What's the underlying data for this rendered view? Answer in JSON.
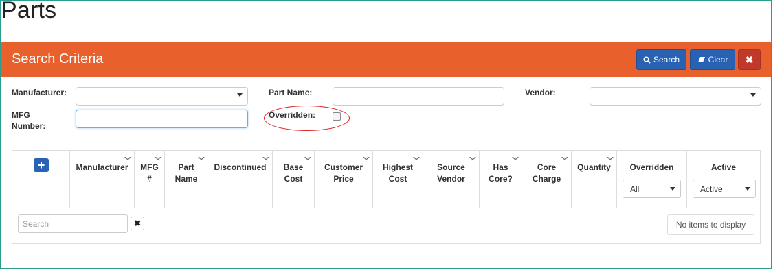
{
  "page": {
    "title": "Parts"
  },
  "panel": {
    "title": "Search Criteria",
    "search_label": "Search",
    "clear_label": "Clear",
    "close_label": "✖",
    "color": "#e8612c"
  },
  "form": {
    "manufacturer_label": "Manufacturer:",
    "manufacturer_value": "",
    "part_name_label": "Part Name:",
    "part_name_value": "",
    "vendor_label": "Vendor:",
    "vendor_value": "",
    "mfg_number_label_1": "MFG",
    "mfg_number_label_2": "Number:",
    "mfg_number_value": "",
    "overridden_label": "Overridden:",
    "overridden_checked": false
  },
  "grid": {
    "add_label": "+",
    "columns": [
      {
        "line1": "Manufacturer",
        "line2": ""
      },
      {
        "line1": "MFG",
        "line2": "#"
      },
      {
        "line1": "Part",
        "line2": "Name"
      },
      {
        "line1": "Discontinued",
        "line2": ""
      },
      {
        "line1": "Base",
        "line2": "Cost"
      },
      {
        "line1": "Customer",
        "line2": "Price"
      },
      {
        "line1": "Highest",
        "line2": "Cost"
      },
      {
        "line1": "Source",
        "line2": "Vendor"
      },
      {
        "line1": "Has",
        "line2": "Core?"
      },
      {
        "line1": "Core",
        "line2": "Charge"
      },
      {
        "line1": "Quantity",
        "line2": ""
      }
    ],
    "overridden_header": "Overridden",
    "overridden_filter": "All",
    "active_header": "Active",
    "active_filter": "Active",
    "search_placeholder": "Search",
    "clear_search_label": "✖",
    "no_items": "No items to display"
  },
  "colors": {
    "primary_button": "#2a62b3",
    "danger_button": "#c0392b"
  }
}
